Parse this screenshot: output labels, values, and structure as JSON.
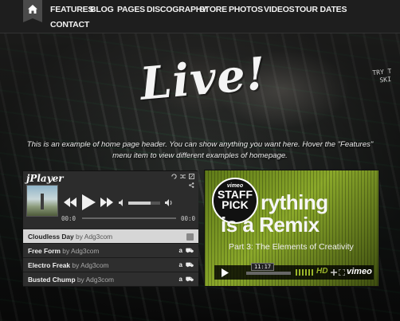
{
  "nav": {
    "home_icon": "home-icon",
    "items": [
      {
        "label": "FEATURES"
      },
      {
        "label": "BLOG"
      },
      {
        "label": "PAGES"
      },
      {
        "label": "DISCOGRAPHY"
      },
      {
        "label": "STORE"
      },
      {
        "label": "PHOTOS"
      },
      {
        "label": "VIDEOS"
      },
      {
        "label": "TOUR DATES"
      },
      {
        "label": "CONTACT"
      }
    ]
  },
  "hero": {
    "title": "Live!",
    "side_text_1": "TRY T",
    "side_text_2": "SKI",
    "text_line_1": "This is an example of home page header. You can show anything you want here. Hover the \"Features\"",
    "text_line_2": "menu item to view different examples of homepage."
  },
  "player": {
    "logo": "jPlayer",
    "time_current": "00:0",
    "time_total": "00:0",
    "volume_level": 0.7,
    "progress": 0.0,
    "tracks": [
      {
        "title": "Cloudless Day",
        "by": "by Adg3com",
        "active": true
      },
      {
        "title": "Free Form",
        "by": "by Adg3com",
        "active": false
      },
      {
        "title": "Electro Freak",
        "by": "by Adg3com",
        "active": false
      },
      {
        "title": "Busted Chump",
        "by": "by Adg3com",
        "active": false
      }
    ]
  },
  "video": {
    "badge_vimeo": "vimeo",
    "badge_staff": "STAFF",
    "badge_pick": "PICK",
    "title_line_1": "rything",
    "title_line_2": "is a Remix",
    "subtitle": "Part 3: The Elements of Creativity",
    "time": "11:17",
    "hd_label": "HD",
    "brand": "vimeo"
  },
  "colors": {
    "nav_bg": "#1e1e1e",
    "active_track_bg": "#d6d6d6",
    "vimeo_green": "#9ab52a"
  }
}
